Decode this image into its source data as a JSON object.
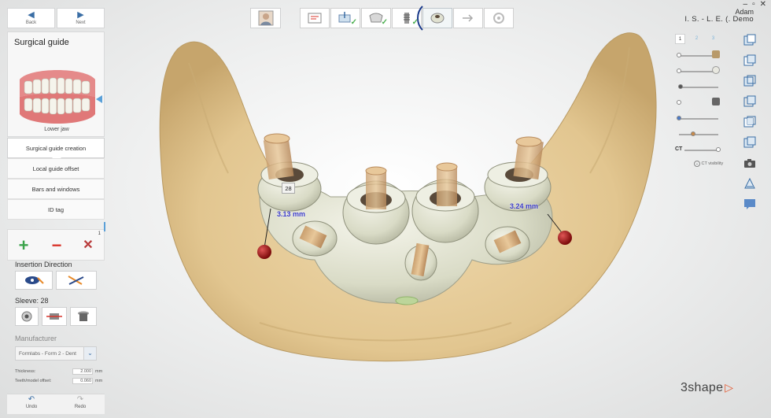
{
  "window": {
    "user": "Adam",
    "case_title": "I. S. - L. E. (. Demo"
  },
  "nav": {
    "back_label": "Back",
    "next_label": "Next"
  },
  "panel": {
    "title": "Surgical guide",
    "jaw_label": "Lower jaw",
    "steps": [
      {
        "label": "Surgical guide creation",
        "active": true
      },
      {
        "label": "Local guide offset",
        "active": false
      },
      {
        "label": "Bars and windows",
        "active": false
      },
      {
        "label": "ID tag",
        "active": false
      }
    ],
    "tools_badge": "1",
    "insertion_direction_label": "Insertion Direction",
    "sleeve_label": "Sleeve: 28",
    "manufacturer_label": "Manufacturer",
    "manufacturer_value": "Formlabs - Form 2 - Dent",
    "params": [
      {
        "label": "Thickness:",
        "value": "2.000",
        "unit": "mm"
      },
      {
        "label": "Teeth/model offset:",
        "value": "0.060",
        "unit": "mm"
      }
    ],
    "undo_label": "Undo",
    "redo_label": "Redo"
  },
  "layers": {
    "tabs": [
      "1",
      "2",
      "3"
    ],
    "ct_label": "CT",
    "ct_visibility_label": "CT visibility"
  },
  "viewport": {
    "sleeve_tag": "28",
    "measurement_left": "3.13 mm",
    "measurement_right": "3.24 mm"
  },
  "brand": {
    "logo_text": "3shape",
    "accent": "#e4572e"
  },
  "colors": {
    "bone": "#e6cb98",
    "guide": "#e0e1d0",
    "link_blue": "#3a6ea5",
    "add_green": "#3aa34a",
    "remove_red": "#d9342b"
  }
}
